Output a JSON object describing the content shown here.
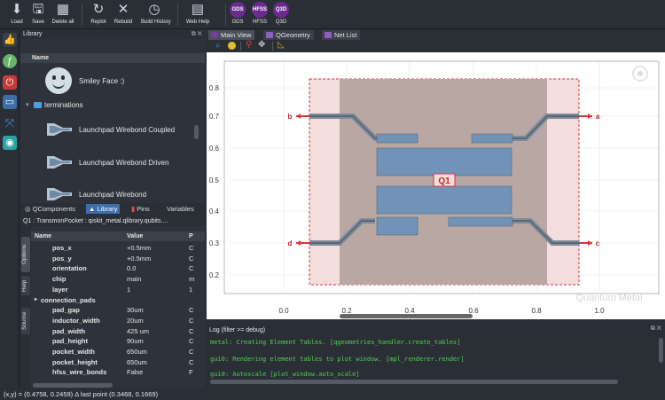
{
  "toolbar": {
    "load": "Load",
    "save": "Save",
    "delete_all": "Delete all",
    "replot": "Replot",
    "rebuild": "Rebuild",
    "build_history": "Build History",
    "web_help": "Web Help",
    "gds": "GDS",
    "hfss": "HFSS",
    "q3d": "Q3D"
  },
  "library": {
    "title": "Library",
    "column_name": "Name",
    "items": [
      {
        "label": "Smiley Face :)",
        "icon": "smiley-face-icon"
      },
      {
        "label": "terminations",
        "icon": "folder-icon"
      },
      {
        "label": "Launchpad Wirebond Coupled",
        "icon": "launchpad-icon"
      },
      {
        "label": "Launchpad Wirebond Driven",
        "icon": "launchpad-icon"
      },
      {
        "label": "Launchpad Wirebond",
        "icon": "launchpad-icon"
      }
    ],
    "tabs": [
      "QComponents",
      "Library",
      "Pins",
      "Variables"
    ]
  },
  "qcomponent": {
    "header": "Q1  :  TransmonPocket  :  qiskit_metal.qlibrary.qubits....",
    "vtabs": [
      "Options",
      "Help",
      "Source"
    ],
    "columns": [
      "Name",
      "Value",
      "P"
    ],
    "rows": [
      {
        "name": "pos_x",
        "value": "+0.5mm",
        "p": "C"
      },
      {
        "name": "pos_y",
        "value": "+0.5mm",
        "p": "C"
      },
      {
        "name": "orientation",
        "value": "0.0",
        "p": "C"
      },
      {
        "name": "chip",
        "value": "main",
        "p": "m"
      },
      {
        "name": "layer",
        "value": "1",
        "p": "1"
      },
      {
        "name": "connection_pads",
        "value": "",
        "p": ""
      },
      {
        "name": "pad_gap",
        "value": "30um",
        "p": "C"
      },
      {
        "name": "inductor_width",
        "value": "20um",
        "p": "C"
      },
      {
        "name": "pad_width",
        "value": "425 um",
        "p": "C"
      },
      {
        "name": "pad_height",
        "value": "90um",
        "p": "C"
      },
      {
        "name": "pocket_width",
        "value": "650um",
        "p": "C"
      },
      {
        "name": "pocket_height",
        "value": "650um",
        "p": "C"
      },
      {
        "name": "hfss_wire_bonds",
        "value": "False",
        "p": "F"
      }
    ]
  },
  "main": {
    "tabs": [
      "Main View",
      "QGeometry",
      "Net List"
    ]
  },
  "plot": {
    "x_ticks": [
      "0.0",
      "0.2",
      "0.4",
      "0.6",
      "0.8",
      "1.0"
    ],
    "y_ticks": [
      "0.8",
      "0.7",
      "0.6",
      "0.5",
      "0.4",
      "0.3",
      "0.2"
    ],
    "qubit_label": "Q1",
    "pin_labels": [
      "a",
      "b",
      "c",
      "d"
    ],
    "watermark": "Quantum Metal"
  },
  "log": {
    "title": "Log  (filter >= debug)",
    "lines": [
      "metal: Creating Element Tables. [qgeometries_handler.create_tables]",
      "gui0: Rendering element tables to plot window. [mpl_renderer.render]",
      "gui0: Autoscale [plot_window.auto_scale]"
    ]
  },
  "status": "(x,y) = (0.4758, 0.2459)   Δ last point (0.3468, 0.1669)",
  "colors": {
    "accent": "#3e6ea8",
    "metal": "#7193b8",
    "pocket": "#b9a7a4",
    "bbox": "#e0303a"
  }
}
